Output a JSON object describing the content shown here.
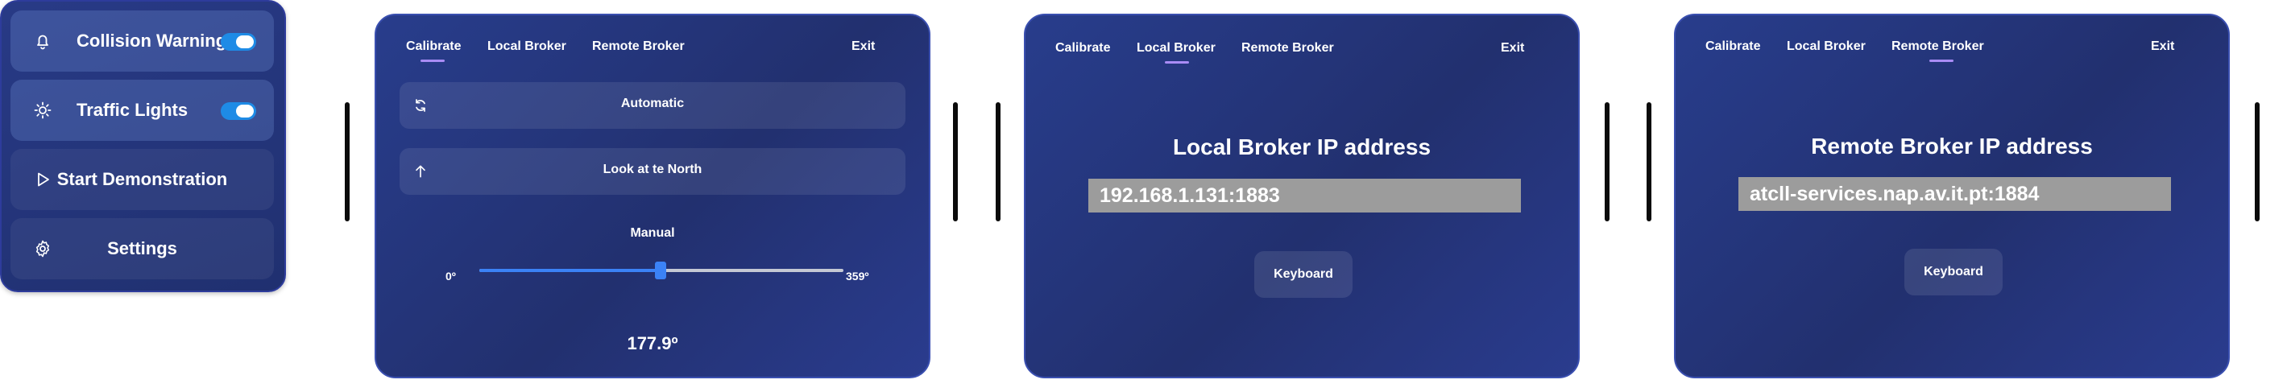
{
  "side_menu": {
    "items": [
      {
        "label": "Collision Warning",
        "icon": "bell-icon",
        "toggle": true
      },
      {
        "label": "Traffic Lights",
        "icon": "sun-icon",
        "toggle": true
      },
      {
        "label": "Start Demonstration",
        "icon": "play-icon",
        "toggle": null
      },
      {
        "label": "Settings",
        "icon": "gear-icon",
        "toggle": null
      }
    ]
  },
  "tabs": {
    "calibrate": "Calibrate",
    "local_broker": "Local Broker",
    "remote_broker": "Remote Broker",
    "exit": "Exit"
  },
  "calibrate_panel": {
    "automatic_label": "Automatic",
    "north_label": "Look at te North",
    "manual_label": "Manual",
    "slider_min": "0º",
    "slider_max": "359º",
    "slider_value_fraction": 0.497,
    "heading_value": "177.9º"
  },
  "local_broker_panel": {
    "title": "Local Broker IP address",
    "ip_value": "192.168.1.131:1883",
    "keyboard_label": "Keyboard"
  },
  "remote_broker_panel": {
    "title": "Remote Broker IP address",
    "ip_value": "atcll-services.nap.av.it.pt:1884",
    "keyboard_label": "Keyboard"
  },
  "colors": {
    "panel_bg": "#24357a",
    "accent_toggle": "#1e8be6",
    "tab_underline": "#a98cf5",
    "slider_fill": "#3b82f6",
    "ip_box": "#9c9c9c"
  }
}
